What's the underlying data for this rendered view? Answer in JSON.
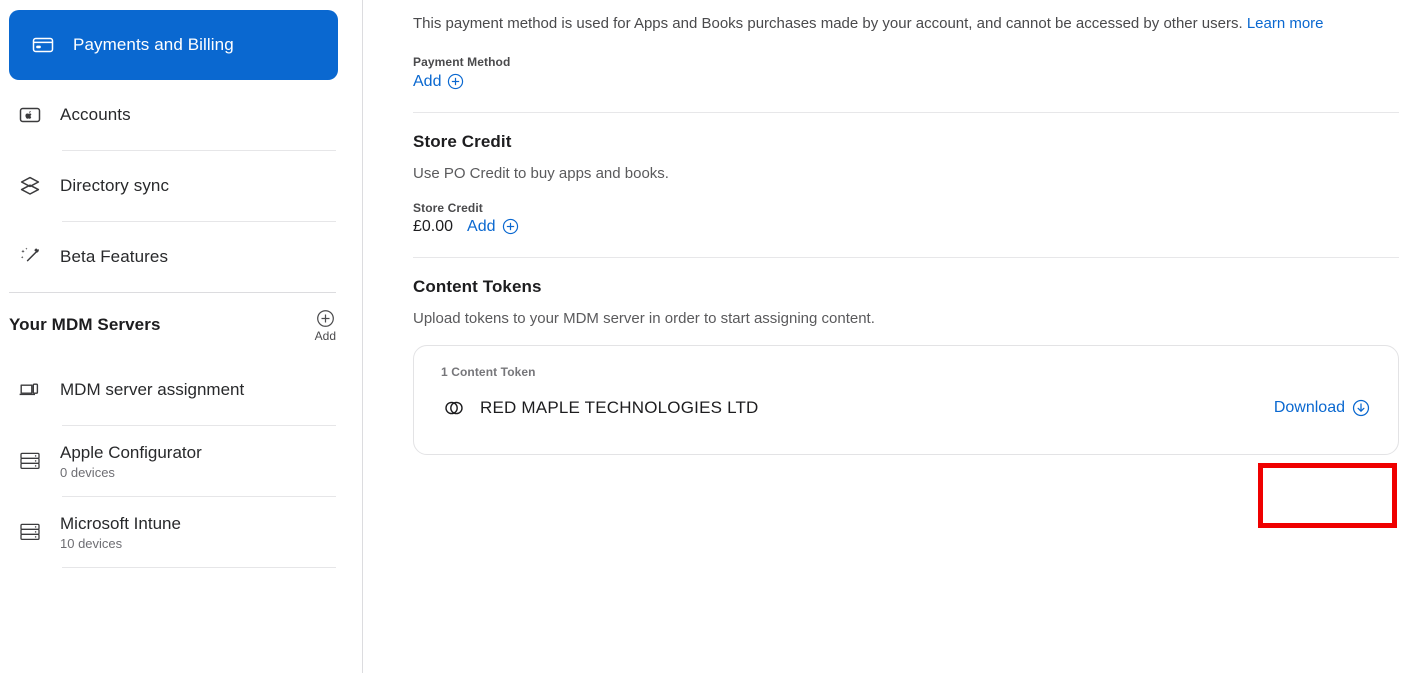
{
  "sidebar": {
    "nav_items": [
      {
        "label": "Payments and Billing",
        "icon": "credit-card-icon",
        "selected": true
      },
      {
        "label": "Accounts",
        "icon": "apple-device-icon",
        "selected": false
      },
      {
        "label": "Directory sync",
        "icon": "layers-icon",
        "selected": false
      },
      {
        "label": "Beta Features",
        "icon": "magic-wand-icon",
        "selected": false
      }
    ],
    "servers_section": {
      "title": "Your MDM Servers",
      "add_label": "Add",
      "items": [
        {
          "name": "MDM server assignment",
          "sub": "",
          "icon": "laptop-icon"
        },
        {
          "name": "Apple Configurator",
          "sub": "0 devices",
          "icon": "server-rack-icon"
        },
        {
          "name": "Microsoft Intune",
          "sub": "10 devices",
          "icon": "server-rack-icon"
        }
      ]
    }
  },
  "main": {
    "intro_text": "This payment method is used for Apps and Books purchases made by your account, and cannot be accessed by other users. ",
    "intro_link": "Learn more",
    "payment_method": {
      "label": "Payment Method",
      "add_label": "Add"
    },
    "store_credit": {
      "title": "Store Credit",
      "description": "Use PO Credit to buy apps and books.",
      "field_label": "Store Credit",
      "amount": "£0.00",
      "add_label": "Add"
    },
    "content_tokens": {
      "title": "Content Tokens",
      "description": "Upload tokens to your MDM server in order to start assigning content.",
      "card_header": "1 Content Token",
      "token_name": "RED MAPLE TECHNOLOGIES LTD",
      "download_label": "Download"
    }
  },
  "colors": {
    "accent_blue": "#0a68d0",
    "highlight_red": "#ef0000",
    "selected_bg": "#0a68d0"
  }
}
